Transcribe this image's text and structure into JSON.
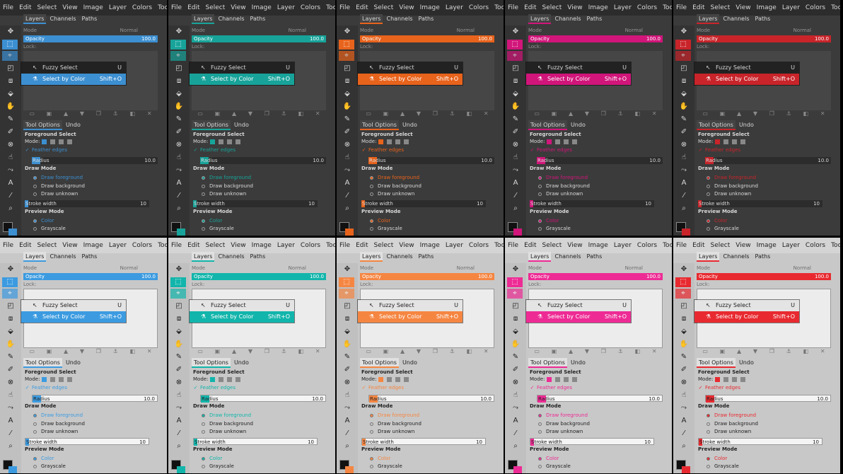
{
  "menu": [
    "File",
    "Edit",
    "Select",
    "View",
    "Image",
    "Layer",
    "Colors",
    "Tools"
  ],
  "layers_tabs": [
    "Layers",
    "Channels",
    "Paths"
  ],
  "tool_tabs": [
    "Tool Options",
    "Undo"
  ],
  "mode_label": "Mode",
  "mode_value": "Normal",
  "opacity_label": "Opacity",
  "opacity_value": "100.0",
  "lock_label": "Lock:",
  "popup": {
    "item1": {
      "label": "Fuzzy Select",
      "shortcut": "U"
    },
    "item2": {
      "label": "Select by Color",
      "shortcut": "Shift+O"
    }
  },
  "tool_options": {
    "title": "Foreground Select",
    "mode_label": "Mode:",
    "feather": "Feather edges",
    "radius_label": "Radius",
    "radius_value": "10.0",
    "draw_mode": "Draw Mode",
    "draw_fg": "Draw foreground",
    "draw_bg": "Draw background",
    "draw_unk": "Draw unknown",
    "stroke_label": "Stroke width",
    "stroke_value": "10",
    "preview_mode": "Preview Mode",
    "color": "Color",
    "grayscale": "Grayscale"
  },
  "themes": [
    {
      "name": "dark-blue",
      "accent": "#3c8fd1",
      "dark": true
    },
    {
      "name": "dark-teal",
      "accent": "#18a39a",
      "dark": true
    },
    {
      "name": "dark-orange",
      "accent": "#e8631c",
      "dark": true
    },
    {
      "name": "dark-magenta",
      "accent": "#d1157a",
      "dark": true
    },
    {
      "name": "dark-red",
      "accent": "#c8242a",
      "dark": true
    },
    {
      "name": "light-blue",
      "accent": "#3c9be0",
      "dark": false
    },
    {
      "name": "light-teal",
      "accent": "#12b5ab",
      "dark": false
    },
    {
      "name": "light-orange",
      "accent": "#f58642",
      "dark": false
    },
    {
      "name": "light-pink",
      "accent": "#ee2b95",
      "dark": false
    },
    {
      "name": "light-red",
      "accent": "#e82a30",
      "dark": false
    }
  ]
}
